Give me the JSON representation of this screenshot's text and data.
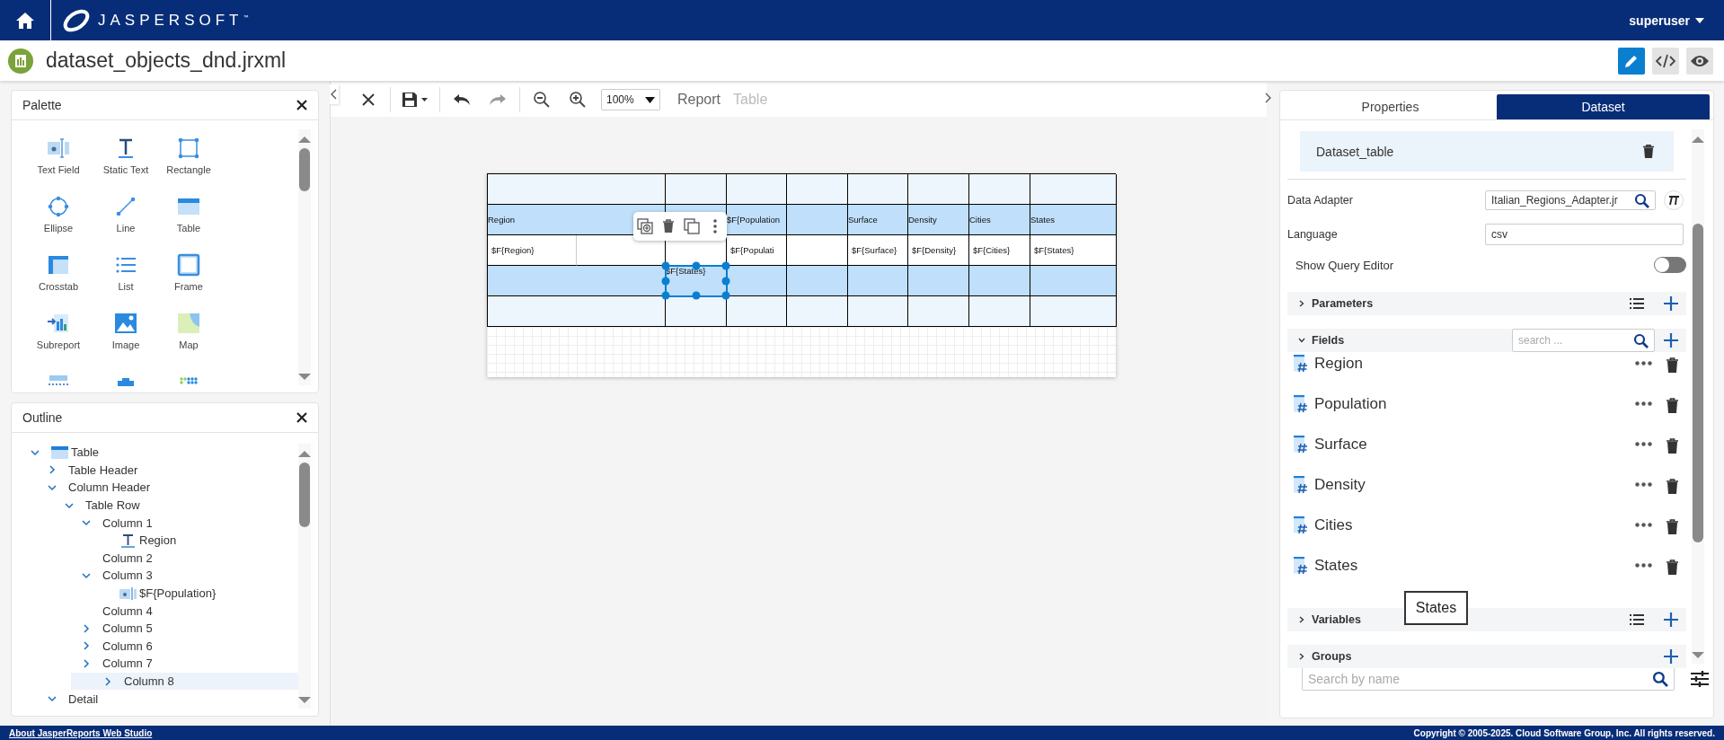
{
  "header": {
    "logo": "JASPERSOFT",
    "trademark": "™",
    "user": "superuser"
  },
  "document": {
    "title": "dataset_objects_dnd.jrxml"
  },
  "mode_buttons": [
    {
      "kind": "edit",
      "selected": true
    },
    {
      "kind": "source",
      "selected": false
    },
    {
      "kind": "preview",
      "selected": false
    }
  ],
  "palette": {
    "title": "Palette",
    "items": [
      {
        "kind": "text-field",
        "label": "Text Field"
      },
      {
        "kind": "static-text",
        "label": "Static Text"
      },
      {
        "kind": "rectangle",
        "label": "Rectangle"
      },
      {
        "kind": "ellipse",
        "label": "Ellipse"
      },
      {
        "kind": "line",
        "label": "Line"
      },
      {
        "kind": "table",
        "label": "Table"
      },
      {
        "kind": "crosstab",
        "label": "Crosstab"
      },
      {
        "kind": "list",
        "label": "List"
      },
      {
        "kind": "frame",
        "label": "Frame"
      },
      {
        "kind": "subreport",
        "label": "Subreport"
      },
      {
        "kind": "image",
        "label": "Image"
      },
      {
        "kind": "map",
        "label": "Map"
      },
      {
        "kind": "break"
      },
      {
        "kind": "band"
      },
      {
        "kind": "dots"
      }
    ]
  },
  "outline": {
    "title": "Outline",
    "tree": [
      {
        "label": "Table",
        "kind": "table",
        "expanded": true,
        "selected": false,
        "children": [
          {
            "label": "Table Header",
            "expanded": false,
            "selected": false
          },
          {
            "label": "Column Header",
            "expanded": true,
            "selected": false,
            "children": [
              {
                "label": "Table Row",
                "expanded": true,
                "selected": false,
                "children": [
                  {
                    "label": "Column 1",
                    "expanded": true,
                    "selected": false,
                    "children": [
                      {
                        "label": "Region",
                        "kind": "static-text",
                        "selected": false
                      }
                    ]
                  },
                  {
                    "label": "Column 2",
                    "selected": false
                  },
                  {
                    "label": "Column 3",
                    "expanded": true,
                    "selected": false,
                    "children": [
                      {
                        "label": "$F{Population}",
                        "kind": "text-field",
                        "selected": false
                      }
                    ]
                  },
                  {
                    "label": "Column 4",
                    "selected": false
                  },
                  {
                    "label": "Column 5",
                    "expanded": false,
                    "selected": false
                  },
                  {
                    "label": "Column 6",
                    "expanded": false,
                    "selected": false
                  },
                  {
                    "label": "Column 7",
                    "expanded": false,
                    "selected": false
                  },
                  {
                    "label": "Column 8",
                    "expanded": false,
                    "selected": true
                  }
                ]
              }
            ]
          },
          {
            "label": "Detail",
            "expanded": true,
            "selected": false
          }
        ]
      }
    ]
  },
  "toolbar": {
    "zoom": "100%",
    "redo_disabled": true,
    "breadcrumbs": [
      {
        "label": "Report",
        "current": false
      },
      {
        "label": "Table",
        "current": true
      }
    ]
  },
  "table": {
    "rows": [
      {
        "kind": "light",
        "cells": [
          {
            "colspan": 2,
            "selected": false
          },
          {
            "selected": false
          },
          {
            "selected": false
          },
          {
            "selected": false
          },
          {
            "selected": false
          },
          {
            "selected": false
          },
          {
            "selected": false
          },
          {
            "selected": false
          }
        ]
      },
      {
        "kind": "header",
        "cells": [
          {
            "text": "Region",
            "colspan": 2,
            "selected": false
          },
          {
            "selected": false
          },
          {
            "text": "$F{Population",
            "selected": false
          },
          {
            "selected": false
          },
          {
            "text": "Surface",
            "selected": false
          },
          {
            "text": "Density",
            "selected": false
          },
          {
            "text": "Cities",
            "selected": false
          },
          {
            "text": "States",
            "selected": false
          }
        ]
      },
      {
        "kind": "white",
        "cells": [
          {
            "text": "$F{Region}",
            "selected": false
          },
          {
            "selected": false
          },
          {
            "selected": false
          },
          {
            "text": "$F{Populati",
            "selected": false
          },
          {
            "selected": false
          },
          {
            "text": "$F{Surface}",
            "selected": false
          },
          {
            "text": "$F{Density}",
            "selected": false
          },
          {
            "text": "$F{Cities}",
            "selected": false
          },
          {
            "text": "$F{States}",
            "selected": false
          }
        ]
      },
      {
        "kind": "header",
        "cells": [
          {
            "colspan": 2,
            "selected": false
          },
          {
            "text": "$F{States}",
            "selected": true
          },
          {
            "selected": false
          },
          {
            "selected": false
          },
          {
            "selected": false
          },
          {
            "selected": false
          },
          {
            "selected": false
          },
          {
            "selected": false
          }
        ]
      },
      {
        "kind": "light",
        "cells": [
          {
            "colspan": 2,
            "selected": false
          },
          {
            "selected": false
          },
          {
            "selected": false
          },
          {
            "selected": false
          },
          {
            "selected": false
          },
          {
            "selected": false
          },
          {
            "selected": false
          },
          {
            "selected": false
          }
        ]
      }
    ]
  },
  "side_panel": {
    "tabs": [
      {
        "label": "Properties",
        "selected": false
      },
      {
        "label": "Dataset",
        "selected": true
      }
    ],
    "dataset_name": "Dataset_table",
    "data_adapter": {
      "label": "Data Adapter",
      "value": "Italian_Regions_Adapter.jr"
    },
    "language": {
      "label": "Language",
      "value": "csv"
    },
    "show_query_editor": {
      "label": "Show Query Editor",
      "on": false
    },
    "sections": [
      {
        "title": "Parameters",
        "expanded": false,
        "list_button": true
      },
      {
        "title": "Fields",
        "expanded": true,
        "list_button": false,
        "search_placeholder": "search ...",
        "fields": [
          {
            "name": "Region"
          },
          {
            "name": "Population"
          },
          {
            "name": "Surface"
          },
          {
            "name": "Density"
          },
          {
            "name": "Cities"
          },
          {
            "name": "States"
          }
        ]
      },
      {
        "title": "Variables",
        "expanded": false,
        "list_button": true
      },
      {
        "title": "Groups",
        "expanded": false,
        "list_button": false
      }
    ],
    "tooltip": "States",
    "search": {
      "placeholder": "Search by name"
    }
  },
  "footer": {
    "about_link": "About JasperReports Web Studio",
    "copyright": "Copyright © 2005-2025. Cloud Software Group, Inc. All rights reserved."
  }
}
